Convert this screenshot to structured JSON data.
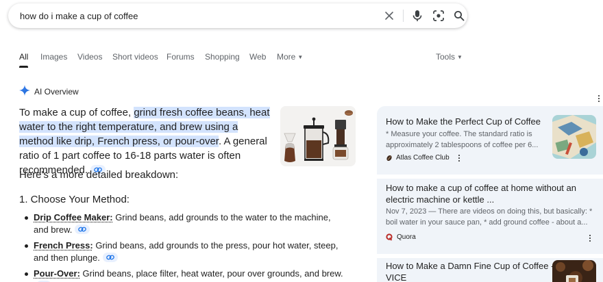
{
  "search": {
    "query": "how do i make a cup of coffee",
    "icons": [
      "close-icon",
      "mic-icon",
      "lens-icon",
      "search-icon"
    ]
  },
  "tabs": [
    {
      "label": "All",
      "active": true
    },
    {
      "label": "Images"
    },
    {
      "label": "Videos"
    },
    {
      "label": "Short videos"
    },
    {
      "label": "Forums"
    },
    {
      "label": "Shopping"
    },
    {
      "label": "Web"
    },
    {
      "label": "More"
    }
  ],
  "tools_label": "Tools",
  "ai_overview": {
    "title": "AI Overview",
    "summary": {
      "lead": "To make a cup of coffee, ",
      "highlight": "grind fresh coffee beans, heat water to the right temperature, and brew using a method like drip, French press, or pour-over",
      "tail": ". A general ratio of 1 part coffee to 16-18 parts water is often recommended."
    },
    "breakdown": "Here's a more detailed breakdown:",
    "step_title": "1. Choose Your Method:",
    "methods": [
      {
        "term": "Drip Coffee Maker:",
        "text": " Grind beans, add grounds to the water to the machine, and brew."
      },
      {
        "term": "French Press:",
        "text": " Grind beans, add grounds to the press, pour hot water, steep, and then plunge."
      },
      {
        "term": "Pour-Over:",
        "text": " Grind beans, place filter, heat water, pour over grounds, and brew."
      }
    ]
  },
  "sources": [
    {
      "title": "How to Make the Perfect Cup of Coffee",
      "snippet_1": "* Measure your coffee. The standard ratio is",
      "snippet_2": "approximately 2 tablespoons of coffee per 6...",
      "site": "Atlas Coffee Club"
    },
    {
      "title_1": "How to make a cup of coffee at home without an",
      "title_2": "electric machine or kettle ...",
      "snippet_1": "Nov 7, 2023 — There are videos on doing this, but basically: *",
      "snippet_2": "boil water in your sauce pan, * add ground coffee - about a...",
      "site": "Quora"
    },
    {
      "title_1": "How to Make a Damn Fine Cup of Coffee -",
      "title_2": "VICE"
    }
  ],
  "colors": {
    "highlight": "#d3e3fd",
    "panel": "#f0f4f9",
    "quora": "#b92b27"
  }
}
